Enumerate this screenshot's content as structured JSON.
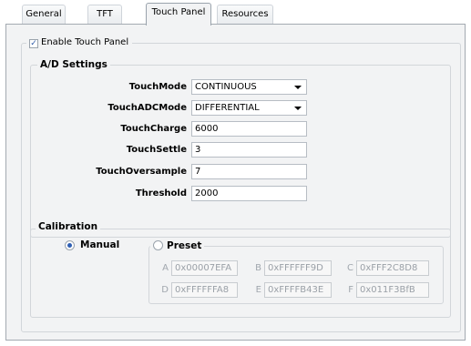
{
  "tabs": [
    {
      "label": "General",
      "active": false
    },
    {
      "label": "TFT",
      "active": false
    },
    {
      "label": "Touch Panel",
      "active": true
    },
    {
      "label": "Resources",
      "active": false
    }
  ],
  "enable_touch_panel": {
    "label": "Enable Touch Panel",
    "checked": true
  },
  "ad_settings": {
    "title": "A/D Settings",
    "rows": [
      {
        "label": "TouchMode",
        "value": "CONTINUOUS",
        "type": "select"
      },
      {
        "label": "TouchADCMode",
        "value": "DIFFERENTIAL",
        "type": "select"
      },
      {
        "label": "TouchCharge",
        "value": "6000",
        "type": "text"
      },
      {
        "label": "TouchSettle",
        "value": "3",
        "type": "text"
      },
      {
        "label": "TouchOversample",
        "value": "7",
        "type": "text"
      },
      {
        "label": "Threshold",
        "value": "2000",
        "type": "text"
      }
    ]
  },
  "calibration": {
    "title": "Calibration",
    "manual": {
      "label": "Manual",
      "selected": true
    },
    "preset": {
      "label": "Preset",
      "selected": false
    },
    "fields": [
      {
        "label": "A",
        "value": "0x00007EFA"
      },
      {
        "label": "B",
        "value": "0xFFFFFF9D"
      },
      {
        "label": "C",
        "value": "0xFFF2C8D8"
      },
      {
        "label": "D",
        "value": "0xFFFFFFA8"
      },
      {
        "label": "E",
        "value": "0xFFFFB43E"
      },
      {
        "label": "F",
        "value": "0x011F3BfB"
      }
    ]
  },
  "colors": {
    "accent": "#2f5fb3",
    "panel_bg": "#f2f3f4",
    "border": "#a3aab1"
  }
}
